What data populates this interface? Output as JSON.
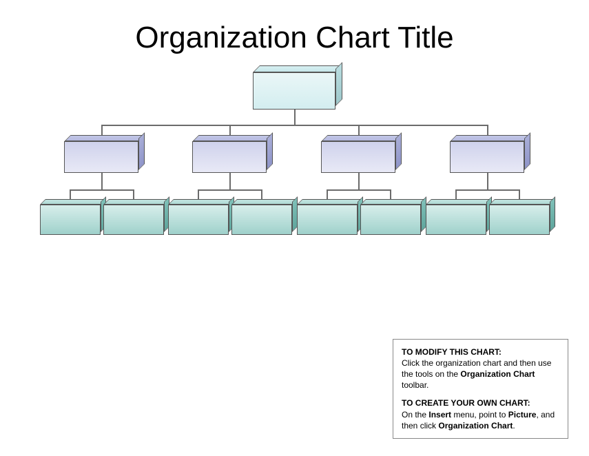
{
  "title": "Organization Chart Title",
  "help": {
    "modify_heading": "TO MODIFY THIS CHART:",
    "modify_pre": "Click the organization chart and then use the tools on the ",
    "modify_bold": "Organization Chart",
    "modify_post": " toolbar.",
    "create_heading": "TO CREATE YOUR OWN CHART:",
    "create_1": "On the ",
    "create_b1": "Insert",
    "create_2": " menu, point to ",
    "create_b2": "Picture",
    "create_3": ", and then click ",
    "create_b3": "Organization Chart",
    "create_4": "."
  },
  "nodes": {
    "root": {
      "label": ""
    },
    "level2": [
      {
        "label": ""
      },
      {
        "label": ""
      },
      {
        "label": ""
      },
      {
        "label": ""
      }
    ],
    "level3": [
      {
        "label": ""
      },
      {
        "label": ""
      },
      {
        "label": ""
      },
      {
        "label": ""
      },
      {
        "label": ""
      },
      {
        "label": ""
      },
      {
        "label": ""
      },
      {
        "label": ""
      }
    ]
  }
}
